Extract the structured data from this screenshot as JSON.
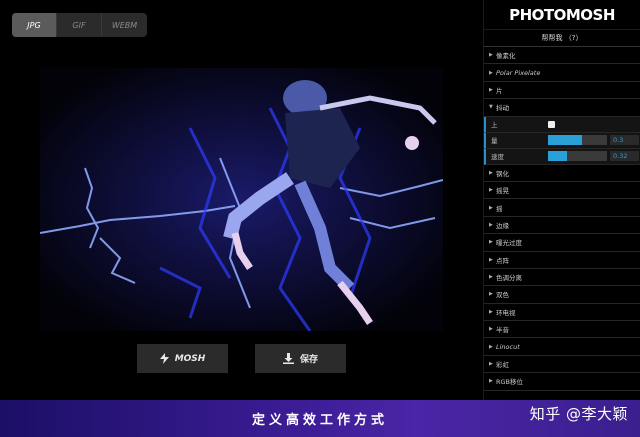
{
  "tabs": [
    {
      "label": "JPG",
      "active": true
    },
    {
      "label": "GIF",
      "active": false
    },
    {
      "label": "WEBM",
      "active": false
    }
  ],
  "actions": {
    "mosh_label": "MOSH",
    "mosh_icon": "lightning-icon",
    "save_label": "保存",
    "save_icon": "download-icon"
  },
  "sidebar": {
    "logo": "PHOTOMOSH",
    "help_label": "帮帮我 （?）",
    "items_before": [
      "像素化",
      "Polar Pixelate",
      "片"
    ],
    "open_item": "抖动",
    "controls": {
      "up_label": "上",
      "up_checked": false,
      "amount_label": "量",
      "amount_value": "0.3",
      "amount_fraction": 0.58,
      "speed_label": "速度",
      "speed_value": "0.32",
      "speed_fraction": 0.32
    },
    "items_after": [
      "钢化",
      "摇晃",
      "摇",
      "边缘",
      "曝光过度",
      "点阵",
      "色调分离",
      "双色",
      "环电视",
      "半音",
      "Linocut",
      "彩虹",
      "RGB移位"
    ]
  },
  "banner": {
    "title": "定义高效工作方式",
    "watermark": "知乎 @李大颖"
  },
  "colors": {
    "accent": "#2aa0d8",
    "banner_start": "#1b0f66",
    "banner_end": "#4a25a6"
  }
}
